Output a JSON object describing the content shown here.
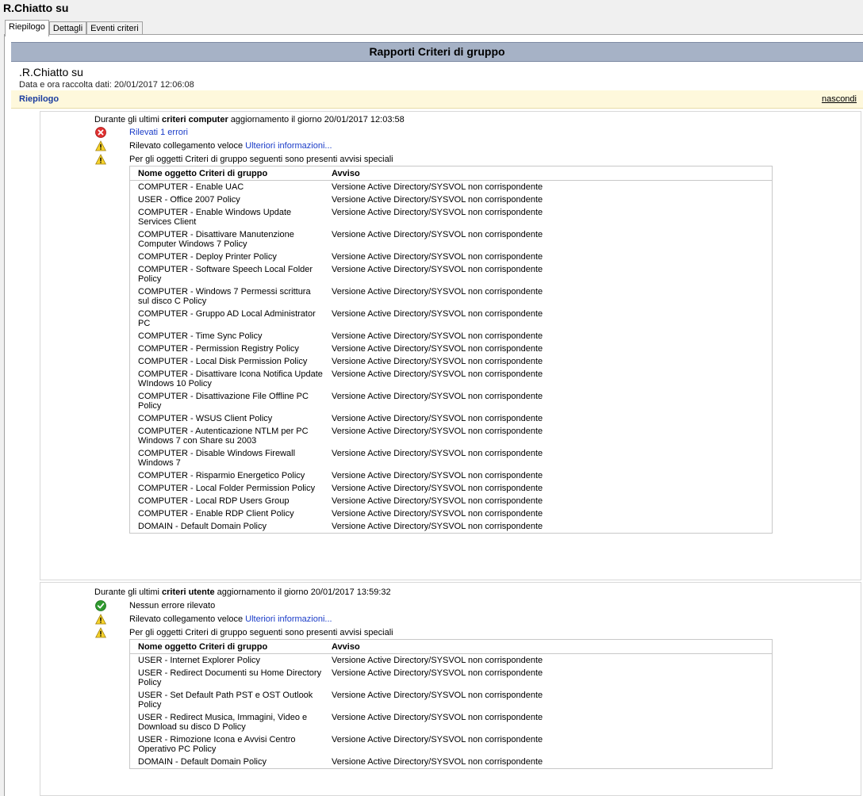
{
  "window": {
    "title": "R.Chiatto su"
  },
  "tabs": [
    {
      "label": "Riepilogo",
      "active": true
    },
    {
      "label": "Dettagli",
      "active": false
    },
    {
      "label": "Eventi criteri",
      "active": false
    }
  ],
  "report": {
    "header": "Rapporti Criteri di gruppo",
    "computer_name": ".R.Chiatto su",
    "collected": "Data e ora raccolta dati: 20/01/2017 12:06:08",
    "summary_label": "Riepilogo",
    "hide_label": "nascondi"
  },
  "computer": {
    "head_prefix": "Durante gli ultimi ",
    "head_bold": "criteri computer",
    "head_suffix": " aggiornamento il giorno 20/01/2017 12:03:58",
    "errors_text": "Rilevati 1 errori",
    "fast_link_text": "Rilevato collegamento veloce ",
    "fast_link_more": "Ulteriori informazioni...",
    "special_warnings": "Per gli oggetti Criteri di gruppo seguenti sono presenti avvisi speciali",
    "table_head": {
      "name": "Nome oggetto Criteri di gruppo",
      "warning": "Avviso"
    },
    "rows": [
      {
        "name": "COMPUTER - Enable UAC",
        "warning": "Versione Active Directory/SYSVOL non corrispondente"
      },
      {
        "name": "USER - Office 2007 Policy",
        "warning": "Versione Active Directory/SYSVOL non corrispondente"
      },
      {
        "name": "COMPUTER - Enable Windows Update Services Client",
        "warning": "Versione Active Directory/SYSVOL non corrispondente"
      },
      {
        "name": "COMPUTER - Disattivare Manutenzione Computer Windows 7 Policy",
        "warning": "Versione Active Directory/SYSVOL non corrispondente"
      },
      {
        "name": "COMPUTER - Deploy Printer Policy",
        "warning": "Versione Active Directory/SYSVOL non corrispondente"
      },
      {
        "name": "COMPUTER - Software Speech Local Folder Policy",
        "warning": "Versione Active Directory/SYSVOL non corrispondente"
      },
      {
        "name": "COMPUTER - Windows 7 Permessi scrittura sul disco C Policy",
        "warning": "Versione Active Directory/SYSVOL non corrispondente"
      },
      {
        "name": "COMPUTER - Gruppo AD Local Administrator PC",
        "warning": "Versione Active Directory/SYSVOL non corrispondente"
      },
      {
        "name": "COMPUTER - Time Sync Policy",
        "warning": "Versione Active Directory/SYSVOL non corrispondente"
      },
      {
        "name": "COMPUTER - Permission Registry Policy",
        "warning": "Versione Active Directory/SYSVOL non corrispondente"
      },
      {
        "name": "COMPUTER - Local Disk Permission Policy",
        "warning": "Versione Active Directory/SYSVOL non corrispondente"
      },
      {
        "name": "COMPUTER - Disattivare Icona Notifica Update WIndows 10 Policy",
        "warning": "Versione Active Directory/SYSVOL non corrispondente"
      },
      {
        "name": "COMPUTER - Disattivazione File Offline PC Policy",
        "warning": "Versione Active Directory/SYSVOL non corrispondente"
      },
      {
        "name": "COMPUTER - WSUS Client Policy",
        "warning": "Versione Active Directory/SYSVOL non corrispondente"
      },
      {
        "name": "COMPUTER - Autenticazione NTLM per PC Windows 7 con Share su 2003",
        "warning": "Versione Active Directory/SYSVOL non corrispondente"
      },
      {
        "name": "COMPUTER - Disable Windows Firewall Windows 7",
        "warning": "Versione Active Directory/SYSVOL non corrispondente"
      },
      {
        "name": "COMPUTER - Risparmio Energetico Policy",
        "warning": "Versione Active Directory/SYSVOL non corrispondente"
      },
      {
        "name": "COMPUTER - Local Folder Permission Policy",
        "warning": "Versione Active Directory/SYSVOL non corrispondente"
      },
      {
        "name": "COMPUTER - Local RDP Users Group",
        "warning": "Versione Active Directory/SYSVOL non corrispondente"
      },
      {
        "name": "COMPUTER - Enable RDP Client Policy",
        "warning": "Versione Active Directory/SYSVOL non corrispondente"
      },
      {
        "name": "DOMAIN - Default Domain Policy",
        "warning": "Versione Active Directory/SYSVOL non corrispondente"
      }
    ]
  },
  "user": {
    "head_prefix": "Durante gli ultimi ",
    "head_bold": "criteri utente",
    "head_suffix": " aggiornamento il giorno 20/01/2017 13:59:32",
    "no_errors_text": "Nessun errore rilevato",
    "fast_link_text": "Rilevato collegamento veloce ",
    "fast_link_more": "Ulteriori informazioni...",
    "special_warnings": "Per gli oggetti Criteri di gruppo seguenti sono presenti avvisi speciali",
    "table_head": {
      "name": "Nome oggetto Criteri di gruppo",
      "warning": "Avviso"
    },
    "rows": [
      {
        "name": "USER - Internet Explorer Policy",
        "warning": "Versione Active Directory/SYSVOL non corrispondente"
      },
      {
        "name": "USER - Redirect Documenti su Home Directory Policy",
        "warning": "Versione Active Directory/SYSVOL non corrispondente"
      },
      {
        "name": "USER - Set Default Path PST e OST Outlook Policy",
        "warning": "Versione Active Directory/SYSVOL non corrispondente"
      },
      {
        "name": "USER - Redirect Musica, Immagini, Video e Download su disco D Policy",
        "warning": "Versione Active Directory/SYSVOL non corrispondente"
      },
      {
        "name": "USER - Rimozione Icona e Avvisi Centro Operativo PC Policy",
        "warning": "Versione Active Directory/SYSVOL non corrispondente"
      },
      {
        "name": "DOMAIN - Default Domain Policy",
        "warning": "Versione Active Directory/SYSVOL non corrispondente"
      }
    ]
  }
}
